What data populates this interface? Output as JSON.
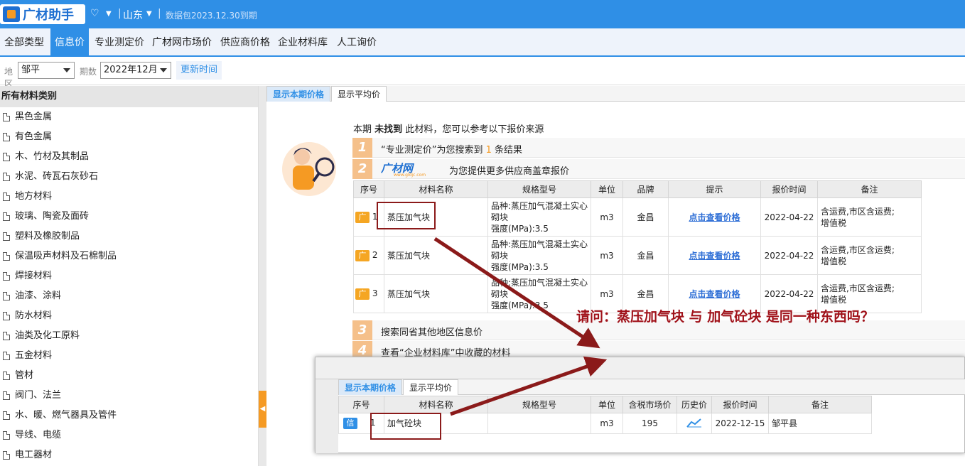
{
  "app": {
    "logo_text": "广材助手",
    "region": "山东",
    "package_info": "数据包2023.12.30到期"
  },
  "tabs": [
    "全部类型",
    "信息价",
    "专业测定价",
    "广材网市场价",
    "供应商价格",
    "企业材料库",
    "人工询价"
  ],
  "filter": {
    "region_label": "地区",
    "region_value": "邹平",
    "period_label": "期数",
    "period_value": "2022年12月",
    "update_button": "更新时间"
  },
  "sidebar": {
    "header": "所有材料类别",
    "items": [
      "黑色金属",
      "有色金属",
      "木、竹材及其制品",
      "水泥、砖瓦石灰砂石",
      "地方材料",
      "玻璃、陶瓷及面砖",
      "塑料及橡胶制品",
      "保温吸声材料及石棉制品",
      "焊接材料",
      "油漆、涂料",
      "防水材料",
      "油类及化工原料",
      "五金材料",
      "管材",
      "阀门、法兰",
      "水、暖、燃气器具及管件",
      "导线、电缆",
      "电工器材"
    ]
  },
  "subtabs": [
    "显示本期价格",
    "显示平均价"
  ],
  "notice": {
    "prefix": "本期",
    "bold": "未找到",
    "suffix": "此材料，您可以参考以下报价来源"
  },
  "steps": [
    {
      "num": "1",
      "text_a": "“专业测定价”为您搜索到",
      "count": "1",
      "text_b": "条结果"
    },
    {
      "num": "2",
      "logo": "广材网",
      "logo_sub": "www.gldjc.com",
      "text": "为您提供更多供应商盖章报价"
    },
    {
      "num": "3",
      "text": "搜索同省其他地区信息价"
    },
    {
      "num": "4",
      "text": "查看“企业材料库”中收藏的材料"
    }
  ],
  "table1": {
    "headers": [
      "序号",
      "材料名称",
      "规格型号",
      "单位",
      "品牌",
      "提示",
      "报价时间",
      "备注"
    ],
    "rows": [
      {
        "tag": "广",
        "idx": "1",
        "name": "蒸压加气块",
        "spec1": "品种:蒸压加气混凝土实心",
        "spec2": "砌块",
        "spec3": "强度(MPa):3.5",
        "unit": "m3",
        "brand": "金昌",
        "hint": "点击查看价格",
        "date": "2022-04-22",
        "note1": "含运费,市区含运费;",
        "note2": "增值税"
      },
      {
        "tag": "广",
        "idx": "2",
        "name": "蒸压加气块",
        "spec1": "品种:蒸压加气混凝土实心",
        "spec2": "砌块",
        "spec3": "强度(MPa):3.5",
        "unit": "m3",
        "brand": "金昌",
        "hint": "点击查看价格",
        "date": "2022-04-22",
        "note1": "含运费,市区含运费;",
        "note2": "增值税"
      },
      {
        "tag": "广",
        "idx": "3",
        "name": "蒸压加气块",
        "spec1": "品种:蒸压加气混凝土实心",
        "spec2": "砌块",
        "spec3": "强度(MPa):3.5",
        "unit": "m3",
        "brand": "金昌",
        "hint": "点击查看价格",
        "date": "2022-04-22",
        "note1": "含运费,市区含运费;",
        "note2": "增值税"
      }
    ]
  },
  "question": "请问：蒸压加气块   与  加气砼块  是同一种东西吗？",
  "inset": {
    "subtabs": [
      "显示本期价格",
      "显示平均价"
    ],
    "headers": [
      "序号",
      "材料名称",
      "规格型号",
      "单位",
      "含税市场价",
      "历史价",
      "报价时间",
      "备注"
    ],
    "row": {
      "tag": "信",
      "idx": "1",
      "name": "加气砼块",
      "spec": "",
      "unit": "m3",
      "price": "195",
      "date": "2022-12-15",
      "note": "邹平县"
    }
  },
  "colors": {
    "primary": "#2f8fe6",
    "accent": "#f59a23",
    "annotation": "#8b1a1a"
  }
}
